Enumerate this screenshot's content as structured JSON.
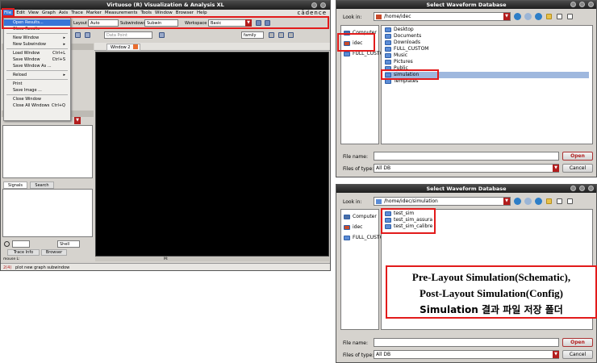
{
  "virtuoso": {
    "title": "Virtuoso (R) Visualization & Analysis XL",
    "brand": "cādence",
    "menus": [
      "File",
      "Edit",
      "View",
      "Graph",
      "Axis",
      "Trace",
      "Marker",
      "Measurements",
      "Tools",
      "Window",
      "Browser",
      "Help"
    ],
    "toolbar": {
      "layout_label": "Layout",
      "layout_value": "Auto",
      "subwindows_label": "Subwindows",
      "subwindows_value": "Subwin",
      "workspace_label": "Workspace",
      "workspace_value": "Basic",
      "data_point_placeholder": "Data Point",
      "family_value": "family"
    },
    "file_menu": [
      {
        "label": "Open Results...",
        "shortcut": "",
        "selected": true
      },
      {
        "label": "Close Results",
        "shortcut": ""
      },
      {
        "sep": true
      },
      {
        "label": "New Window",
        "shortcut": "",
        "submenu": true
      },
      {
        "label": "New Subwindow",
        "shortcut": "",
        "submenu": true
      },
      {
        "sep": true
      },
      {
        "label": "Load Window",
        "shortcut": "Ctrl+L"
      },
      {
        "label": "Save Window",
        "shortcut": "Ctrl+S"
      },
      {
        "label": "Save Window As ...",
        "shortcut": ""
      },
      {
        "sep": true
      },
      {
        "label": "Reload",
        "shortcut": "",
        "submenu": true
      },
      {
        "sep": true
      },
      {
        "label": "Print",
        "shortcut": ""
      },
      {
        "label": "Save Image ...",
        "shortcut": ""
      },
      {
        "sep": true
      },
      {
        "label": "Close Window",
        "shortcut": ""
      },
      {
        "label": "Close All Windows",
        "shortcut": "Ctrl+Q"
      }
    ],
    "window_tab": "Window 2",
    "signals_tabs": [
      "Signals",
      "Search"
    ],
    "bottom_tabs": [
      "Trace Info",
      "Browser"
    ],
    "shell_value": "Shell",
    "mouse_label": "mouse L:",
    "m_label": "M:",
    "line_number": "2(4)",
    "status_text": "plot new graph subwindow"
  },
  "dialog1": {
    "title": "Select Waveform Database",
    "look_in_label": "Look in:",
    "look_in_value": "/home/idec",
    "places": [
      "Computer",
      "idec",
      "FULL_CUSTOM"
    ],
    "files": [
      "Desktop",
      "Documents",
      "Downloads",
      "FULL_CUSTOM",
      "Music",
      "Pictures",
      "Public",
      "simulation",
      "Templates"
    ],
    "file_name_label": "File name:",
    "file_name_value": "",
    "files_of_type_label": "Files of type:",
    "files_of_type_value": "All DB",
    "open_button": "Open",
    "cancel_button": "Cancel"
  },
  "dialog2": {
    "title": "Select Waveform Database",
    "look_in_label": "Look in:",
    "look_in_value": "/home/idec/simulation",
    "places": [
      "Computer",
      "idec",
      "FULL_CUSTOM"
    ],
    "files": [
      "test_sim",
      "test_sim_assura",
      "test_sim_calibre"
    ],
    "file_name_label": "File name:",
    "file_name_value": "",
    "files_of_type_label": "Files of type:",
    "files_of_type_value": "All DB",
    "open_button": "Open",
    "cancel_button": "Cancel"
  },
  "annotation": {
    "line1": "Pre-Layout Simulation(Schematic),",
    "line2": "Post-Layout Simulation(Config)",
    "line3": "Simulation 결과 파일 저장 폴더"
  },
  "colors": {
    "highlight_red": "#e21b1b",
    "dropdown_red": "#b21c1c",
    "selection_blue": "#3875d7",
    "panel_gray": "#d6d3ce"
  }
}
